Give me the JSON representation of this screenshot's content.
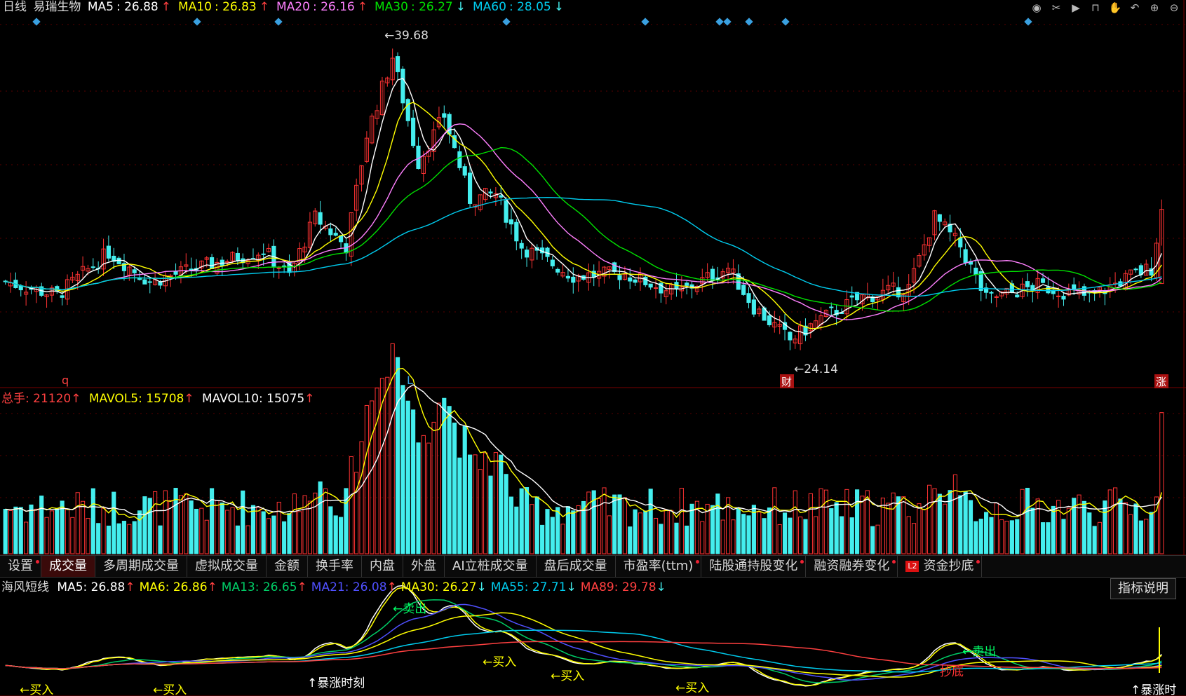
{
  "header": {
    "period": "日线",
    "stock_name": "易瑞生物",
    "ma": [
      {
        "label": "MA5",
        "value": "26.88",
        "arrow": "↑",
        "color": "#ffffff"
      },
      {
        "label": "MA10",
        "value": "26.83",
        "arrow": "↑",
        "color": "#ffff00"
      },
      {
        "label": "MA20",
        "value": "26.16",
        "arrow": "↑",
        "color": "#ff80ff"
      },
      {
        "label": "MA30",
        "value": "26.27",
        "arrow": "↓",
        "color": "#00e000"
      },
      {
        "label": "MA60",
        "value": "28.05",
        "arrow": "↓",
        "color": "#00ccee"
      }
    ]
  },
  "toolbar": {
    "icons": [
      "eye-icon",
      "scissors-icon",
      "play-icon",
      "lock-icon",
      "hand-icon",
      "undo-icon",
      "zoom-in-icon",
      "zoom-out-icon"
    ]
  },
  "price_chart": {
    "max_label": "39.68",
    "min_label": "24.14",
    "markers": [
      "q",
      "L",
      "财",
      "涨"
    ]
  },
  "volume_header": {
    "total": {
      "label": "总手",
      "value": "21120",
      "arrow": "↑"
    },
    "mavol5": {
      "label": "MAVOL5",
      "value": "15708",
      "arrow": "↑"
    },
    "mavol10": {
      "label": "MAVOL10",
      "value": "15075",
      "arrow": "↑"
    }
  },
  "tabs": [
    {
      "label": "设置",
      "dot": true
    },
    {
      "label": "成交量",
      "active": true
    },
    {
      "label": "多周期成交量"
    },
    {
      "label": "虚拟成交量"
    },
    {
      "label": "金额"
    },
    {
      "label": "换手率"
    },
    {
      "label": "内盘"
    },
    {
      "label": "外盘"
    },
    {
      "label": "AI立桩成交量"
    },
    {
      "label": "盘后成交量"
    },
    {
      "label": "市盈率(ttm)",
      "dot": true
    },
    {
      "label": "陆股通持股变化",
      "dot": true
    },
    {
      "label": "融资融券变化",
      "dot": true
    },
    {
      "label": "资金抄底",
      "badge": "L2",
      "dot": true
    }
  ],
  "indicator": {
    "name": "海风短线",
    "ma": [
      {
        "label": "MA5",
        "value": "26.88",
        "arrow": "↑",
        "color": "#ffffff"
      },
      {
        "label": "MA6",
        "value": "26.86",
        "arrow": "↑",
        "color": "#ffff00"
      },
      {
        "label": "MA13",
        "value": "26.65",
        "arrow": "↑",
        "color": "#00cc66"
      },
      {
        "label": "MA21",
        "value": "26.08",
        "arrow": "↑",
        "color": "#5050ff"
      },
      {
        "label": "MA30",
        "value": "26.27",
        "arrow": "↓",
        "color": "#ffff00"
      },
      {
        "label": "MA55",
        "value": "27.71",
        "arrow": "↓",
        "color": "#00ccee"
      },
      {
        "label": "MA89",
        "value": "29.78",
        "arrow": "↓",
        "color": "#ff4040"
      }
    ],
    "explain_button": "指标说明",
    "signals": {
      "buy": "←买入",
      "sell": "←卖出",
      "surge": "↑暴涨时刻",
      "surge_short": "↑暴涨时",
      "bottom": "抄底"
    }
  },
  "colors": {
    "up": "#ff3333",
    "down": "#44eeee",
    "grid": "#5a0000"
  }
}
